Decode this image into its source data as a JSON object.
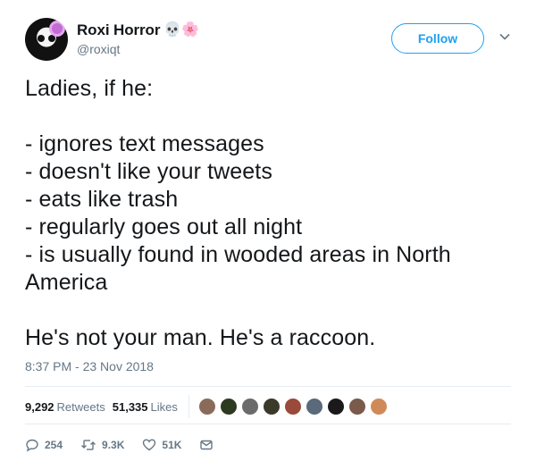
{
  "user": {
    "display_name": "Roxi Horror",
    "name_emojis": "💀🌸",
    "handle": "@roxiqt"
  },
  "follow_button": {
    "label": "Follow"
  },
  "tweet": {
    "text": "Ladies, if he:\n\n- ignores text messages\n- doesn't like your tweets\n- eats like trash\n- regularly goes out all night\n- is usually found in wooded areas in North America\n\nHe's not your man. He's a raccoon.",
    "timestamp": "8:37 PM - 23 Nov 2018"
  },
  "stats": {
    "retweets_count": "9,292",
    "retweets_label": "Retweets",
    "likes_count": "51,335",
    "likes_label": "Likes"
  },
  "actions": {
    "replies": "254",
    "retweets": "9.3K",
    "likes": "51K"
  },
  "colors": {
    "accent": "#1da1f2",
    "muted": "#657786",
    "text": "#14171a"
  },
  "likers": [
    "#8a6b5a",
    "#2d3a20",
    "#6b6b6b",
    "#3a3a2a",
    "#9a4a3a",
    "#5a6a7a",
    "#1a1a1a",
    "#7a5a4a",
    "#d08a5a"
  ]
}
